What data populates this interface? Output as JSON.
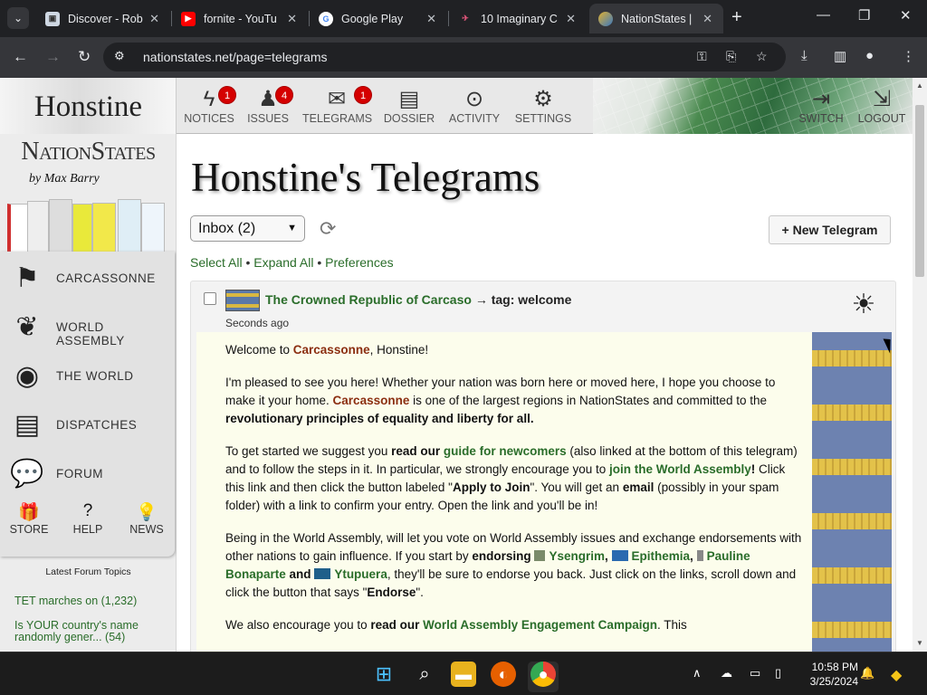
{
  "browser": {
    "tabs": [
      {
        "title": "Discover - Rob",
        "favicon": "discover-icon",
        "active": false
      },
      {
        "title": "fornite - YouTu",
        "favicon": "youtube-icon",
        "active": false
      },
      {
        "title": "Google Play",
        "favicon": "google-icon",
        "active": false
      },
      {
        "title": "10 Imaginary C",
        "favicon": "bird-icon",
        "active": false
      },
      {
        "title": "NationStates |",
        "favicon": "nationstates-icon",
        "active": true
      }
    ],
    "url": "nationstates.net/page=telegrams"
  },
  "header": {
    "nation_name": "Honstine",
    "nav": [
      {
        "label": "NOTICES",
        "badge": "1",
        "icon": "lightning-icon"
      },
      {
        "label": "ISSUES",
        "badge": "4",
        "icon": "person-icon"
      },
      {
        "label": "TELEGRAMS",
        "badge": "1",
        "icon": "envelope-icon"
      },
      {
        "label": "DOSSIER",
        "badge": "",
        "icon": "book-icon"
      },
      {
        "label": "ACTIVITY",
        "badge": "",
        "icon": "satellite-icon"
      },
      {
        "label": "SETTINGS",
        "badge": "",
        "icon": "gears-icon"
      }
    ],
    "right_nav": [
      {
        "label": "SWITCH",
        "icon": "switch-icon"
      },
      {
        "label": "LOGOUT",
        "icon": "logout-icon"
      }
    ]
  },
  "sidebar": {
    "logo": "NationStates",
    "byline": "by Max Barry",
    "items": [
      {
        "label": "CARCASSONNE",
        "icon": "flag-icon"
      },
      {
        "label": "WORLD ASSEMBLY",
        "icon": "laurel-icon"
      },
      {
        "label": "THE WORLD",
        "icon": "globe-icon"
      },
      {
        "label": "DISPATCHES",
        "icon": "newspaper-icon"
      },
      {
        "label": "FORUM",
        "icon": "speech-bubbles-icon"
      }
    ],
    "mini": [
      {
        "label": "STORE",
        "icon": "gift-icon"
      },
      {
        "label": "HELP",
        "icon": "question-icon"
      },
      {
        "label": "NEWS",
        "icon": "lightbulb-icon"
      }
    ],
    "forum_heading": "Latest Forum Topics",
    "forum_topics": [
      "TET marches on (1,232)",
      "Is YOUR country's name randomly gener... (54)"
    ]
  },
  "main": {
    "title": "Honstine's Telegrams",
    "folder": "Inbox (2)",
    "new_button": "+ New Telegram",
    "tools": {
      "select_all": "Select All",
      "bullet": "•",
      "expand_all": "Expand All",
      "preferences": "Preferences"
    },
    "telegram": {
      "from": "The Crowned Republic of Carcaso",
      "arrow_tag": "→ tag: welcome",
      "time": "Seconds ago",
      "p1": {
        "a": "Welcome to ",
        "region": "Carcassonne",
        "b": ", Honstine!"
      },
      "p2": {
        "a": "I'm pleased to see you here! Whether your nation was born here or moved here, I hope you choose to make it your home. ",
        "region": "Carcassonne",
        "b": " is one of the largest regions in NationStates and committed to the ",
        "bold": "revolutionary principles of equality and liberty for all."
      },
      "p3": {
        "a": "To get started we suggest you ",
        "b1": "read our",
        "link1": "guide for newcomers",
        "c": " (also linked at the bottom of this telegram) and to follow the steps in it. In particular, we strongly encourage you to ",
        "link2": "join the World Assembly",
        "excl": "!",
        "d": " Click this link and then click the button labeled \"",
        "b2": "Apply to Join",
        "e": "\". You will get an ",
        "b3": "email",
        "f": " (possibly in your spam folder) with a link to confirm your entry. Open the link and you'll be in!"
      },
      "p4": {
        "a": "Being in the World Assembly, will let you vote on World Assembly issues and exchange endorsements with other nations to gain influence. If you start by ",
        "b1": "endorsing",
        "n1": "Ysengrim",
        "comma": ",",
        "n2": "Epithemia",
        "n3": "Pauline Bonaparte",
        "and": "and",
        "n4": "Ytupuera",
        "c": ", they'll be sure to endorse you back. Just click on the links, scroll down and click the button that says \"",
        "b2": "Endorse",
        "d": "\"."
      },
      "p5": {
        "a": "We also encourage you to ",
        "b1": "read our",
        "link": "World Assembly Engagement Campaign",
        "c": ". This"
      }
    }
  },
  "taskbar": {
    "time": "10:58 PM",
    "date": "3/25/2024"
  }
}
